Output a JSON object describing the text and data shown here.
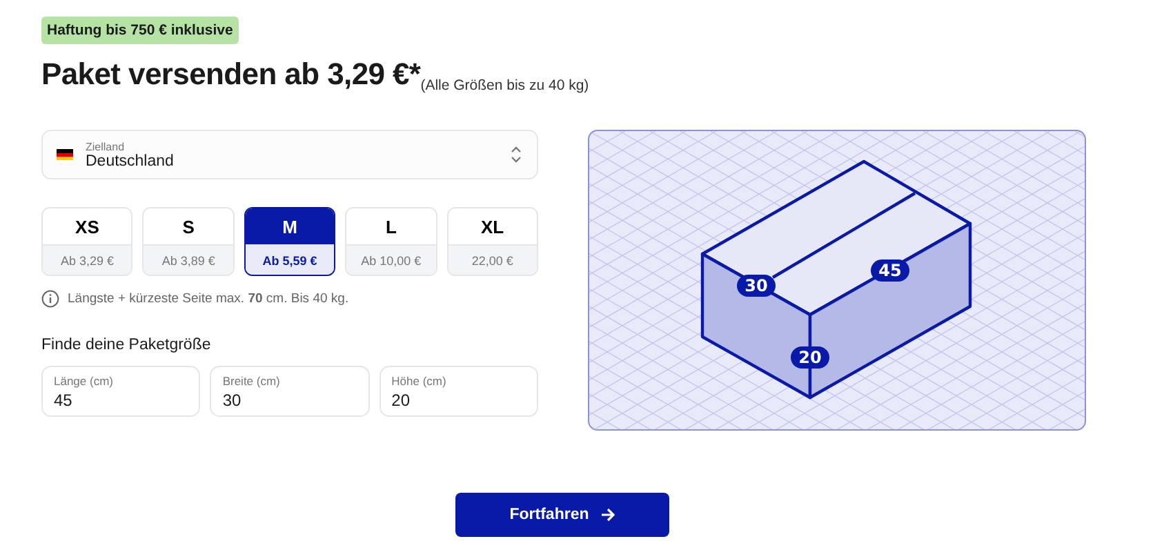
{
  "badge": "Haftung bis 750 € inklusive",
  "heading": {
    "title": "Paket versenden ab 3,29 €*",
    "note": "(Alle Größen bis zu 40 kg)"
  },
  "country_select": {
    "label": "Zielland",
    "value": "Deutschland"
  },
  "sizes": [
    {
      "label": "XS",
      "price": "Ab 3,29 €",
      "selected": false
    },
    {
      "label": "S",
      "price": "Ab 3,89 €",
      "selected": false
    },
    {
      "label": "M",
      "price": "Ab 5,59 €",
      "selected": true
    },
    {
      "label": "L",
      "price": "Ab 10,00 €",
      "selected": false
    },
    {
      "label": "XL",
      "price": "22,00 €",
      "selected": false
    }
  ],
  "info": "Längste + kürzeste Seite max. **70** cm. Bis 40 kg.",
  "finder": {
    "title": "Finde deine Paketgröße",
    "fields": [
      {
        "label": "Länge (cm)",
        "value": "45"
      },
      {
        "label": "Breite (cm)",
        "value": "30"
      },
      {
        "label": "Höhe (cm)",
        "value": "20"
      }
    ]
  },
  "illustration": {
    "labels": [
      {
        "kind": "width",
        "text": "30"
      },
      {
        "kind": "length",
        "text": "45"
      },
      {
        "kind": "height",
        "text": "20"
      }
    ]
  },
  "continue_button": "Fortfahren"
}
